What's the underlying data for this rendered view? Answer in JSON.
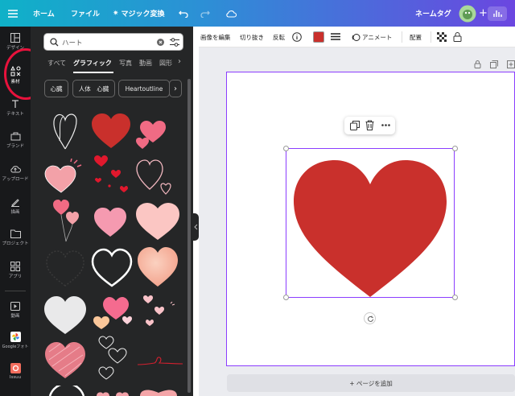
{
  "topbar": {
    "home": "ホーム",
    "file": "ファイル",
    "magic": "マジック変換",
    "name_tag": "ネームタグ"
  },
  "rail": {
    "items": [
      {
        "label": "デザイン",
        "icon": "layout-icon"
      },
      {
        "label": "素材",
        "icon": "elements-icon"
      },
      {
        "label": "テキスト",
        "icon": "text-icon"
      },
      {
        "label": "ブランド",
        "icon": "brand-icon"
      },
      {
        "label": "アップロード",
        "icon": "upload-icon"
      },
      {
        "label": "描画",
        "icon": "draw-icon"
      },
      {
        "label": "プロジェクト",
        "icon": "folder-icon"
      },
      {
        "label": "アプリ",
        "icon": "apps-icon"
      },
      {
        "label": "動画",
        "icon": "video-icon"
      },
      {
        "label": "Googleフォト",
        "icon": "google-photos-icon"
      },
      {
        "label": "Issuu",
        "icon": "issuu-icon"
      }
    ]
  },
  "search": {
    "value": "ハート"
  },
  "tabs": [
    "すべて",
    "グラフィック",
    "写真",
    "動画",
    "図形"
  ],
  "chips": [
    "心臓",
    "人体　心臓",
    "Heartoutline"
  ],
  "toolbar": {
    "edit_image": "画像を編集",
    "crop": "切り抜き",
    "flip": "反転",
    "animate": "アニメート",
    "position": "配置"
  },
  "canvas": {
    "add_page": "+ ページを追加"
  },
  "colors": {
    "heart": "#c9302c",
    "accent": "#8b3dff",
    "highlight": "#e8123c"
  }
}
